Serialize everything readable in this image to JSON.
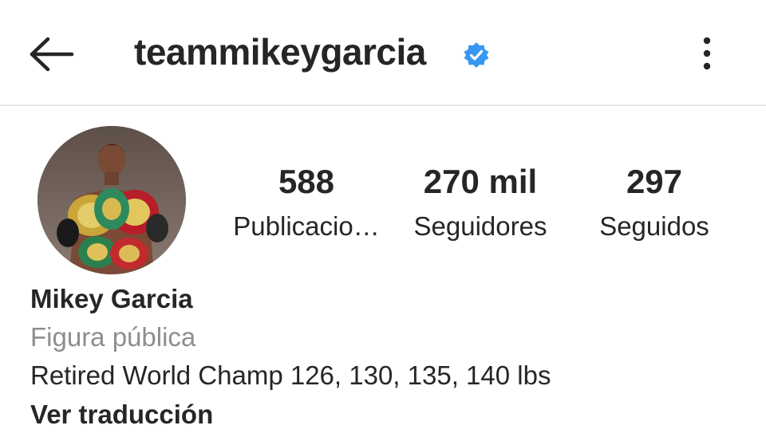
{
  "header": {
    "username": "teammikeygarcia",
    "verified": true,
    "back_icon": "arrow-left-icon",
    "more_icon": "more-vertical-icon",
    "verified_icon": "verified-badge-icon",
    "verified_color": "#3897f0"
  },
  "stats": {
    "posts": {
      "value": "588",
      "label": "Publicacio…"
    },
    "followers": {
      "value": "270 mil",
      "label": "Seguidores"
    },
    "following": {
      "value": "297",
      "label": "Seguidos"
    }
  },
  "bio": {
    "name": "Mikey Garcia",
    "category": "Figura pública",
    "text": "Retired World Champ 126, 130, 135, 140 lbs",
    "translate_link": "Ver traducción"
  },
  "colors": {
    "text": "#262626",
    "secondary_text": "#8e8e8e",
    "divider": "#e6e6e6",
    "background": "#ffffff"
  }
}
